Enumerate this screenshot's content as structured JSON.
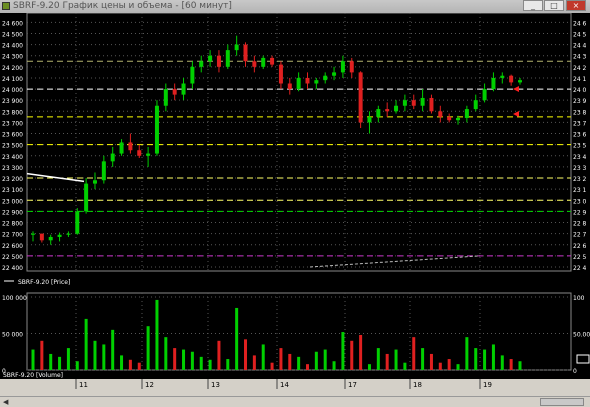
{
  "window": {
    "title": "SBRF-9.20 График цены и объема - [60 минут]",
    "buttons": {
      "minimize": "_",
      "maximize": "□",
      "close": "×"
    }
  },
  "price_panel": {
    "legend": "SBRF-9.20 [Price]",
    "y_ticks": [
      "24 600",
      "24 500",
      "24 400",
      "24 300",
      "24 200",
      "24 100",
      "24 000",
      "23 900",
      "23 800",
      "23 700",
      "23 600",
      "23 500",
      "23 400",
      "23 300",
      "23 200",
      "23 100",
      "23 000",
      "22 900",
      "22 800",
      "22 700",
      "22 600",
      "22 500",
      "22 400"
    ],
    "y_ticks_right": [
      "24 6",
      "24 5",
      "24 4",
      "24 3",
      "24 2",
      "24 1",
      "24 0",
      "23 9",
      "23 8",
      "23 7",
      "23 6",
      "23 5",
      "23 4",
      "23 3",
      "23 2",
      "23 1",
      "23 0",
      "22 9",
      "22 8",
      "22 7",
      "22 6",
      "22 5",
      "22 4"
    ]
  },
  "volume_panel": {
    "legend": "SBRF-9.20 [Volume]",
    "y_ticks": [
      "100 000",
      "50 000",
      "0"
    ],
    "y_ticks_right": [
      "100",
      "50.00",
      "0"
    ]
  },
  "x_axis": {
    "labels": [
      "11",
      "12",
      "13",
      "14",
      "17",
      "18",
      "19"
    ]
  },
  "chart_data": [
    {
      "type": "candlestick",
      "series": [
        {
          "name": "SBRF-9.20",
          "values": [
            {
              "o": 22690,
              "h": 22720,
              "l": 22630,
              "c": 22700
            },
            {
              "o": 22700,
              "h": 22700,
              "l": 22620,
              "c": 22640
            },
            {
              "o": 22640,
              "h": 22690,
              "l": 22600,
              "c": 22670
            },
            {
              "o": 22670,
              "h": 22710,
              "l": 22630,
              "c": 22690
            },
            {
              "o": 22690,
              "h": 22720,
              "l": 22670,
              "c": 22700
            },
            {
              "o": 22700,
              "h": 22930,
              "l": 22690,
              "c": 22900
            },
            {
              "o": 22900,
              "h": 23200,
              "l": 22880,
              "c": 23150
            },
            {
              "o": 23150,
              "h": 23250,
              "l": 23100,
              "c": 23180
            },
            {
              "o": 23180,
              "h": 23400,
              "l": 23150,
              "c": 23350
            },
            {
              "o": 23350,
              "h": 23480,
              "l": 23300,
              "c": 23420
            },
            {
              "o": 23420,
              "h": 23550,
              "l": 23400,
              "c": 23520
            },
            {
              "o": 23520,
              "h": 23600,
              "l": 23420,
              "c": 23450
            },
            {
              "o": 23450,
              "h": 23500,
              "l": 23380,
              "c": 23400
            },
            {
              "o": 23400,
              "h": 23480,
              "l": 23300,
              "c": 23420
            },
            {
              "o": 23420,
              "h": 23900,
              "l": 23400,
              "c": 23850
            },
            {
              "o": 23850,
              "h": 24050,
              "l": 23800,
              "c": 24000
            },
            {
              "o": 24000,
              "h": 24050,
              "l": 23900,
              "c": 23950
            },
            {
              "o": 23950,
              "h": 24100,
              "l": 23900,
              "c": 24050
            },
            {
              "o": 24050,
              "h": 24250,
              "l": 24000,
              "c": 24200
            },
            {
              "o": 24200,
              "h": 24300,
              "l": 24150,
              "c": 24250
            },
            {
              "o": 24250,
              "h": 24350,
              "l": 24200,
              "c": 24300
            },
            {
              "o": 24300,
              "h": 24350,
              "l": 24150,
              "c": 24200
            },
            {
              "o": 24200,
              "h": 24400,
              "l": 24180,
              "c": 24350
            },
            {
              "o": 24350,
              "h": 24480,
              "l": 24300,
              "c": 24400
            },
            {
              "o": 24400,
              "h": 24420,
              "l": 24200,
              "c": 24250
            },
            {
              "o": 24250,
              "h": 24300,
              "l": 24150,
              "c": 24200
            },
            {
              "o": 24200,
              "h": 24300,
              "l": 24180,
              "c": 24280
            },
            {
              "o": 24280,
              "h": 24300,
              "l": 24200,
              "c": 24220
            },
            {
              "o": 24220,
              "h": 24250,
              "l": 24000,
              "c": 24050
            },
            {
              "o": 24050,
              "h": 24100,
              "l": 23950,
              "c": 24000
            },
            {
              "o": 24000,
              "h": 24150,
              "l": 23980,
              "c": 24100
            },
            {
              "o": 24100,
              "h": 24150,
              "l": 24000,
              "c": 24050
            },
            {
              "o": 24050,
              "h": 24100,
              "l": 24000,
              "c": 24080
            },
            {
              "o": 24080,
              "h": 24150,
              "l": 24050,
              "c": 24120
            },
            {
              "o": 24120,
              "h": 24200,
              "l": 24080,
              "c": 24150
            },
            {
              "o": 24150,
              "h": 24300,
              "l": 24100,
              "c": 24250
            },
            {
              "o": 24250,
              "h": 24280,
              "l": 24100,
              "c": 24150
            },
            {
              "o": 24150,
              "h": 24160,
              "l": 23650,
              "c": 23700
            },
            {
              "o": 23700,
              "h": 23800,
              "l": 23600,
              "c": 23750
            },
            {
              "o": 23750,
              "h": 23850,
              "l": 23700,
              "c": 23820
            },
            {
              "o": 23820,
              "h": 23880,
              "l": 23750,
              "c": 23800
            },
            {
              "o": 23800,
              "h": 23900,
              "l": 23780,
              "c": 23850
            },
            {
              "o": 23850,
              "h": 23950,
              "l": 23800,
              "c": 23900
            },
            {
              "o": 23900,
              "h": 23950,
              "l": 23820,
              "c": 23850
            },
            {
              "o": 23850,
              "h": 24000,
              "l": 23800,
              "c": 23920
            },
            {
              "o": 23920,
              "h": 23950,
              "l": 23780,
              "c": 23800
            },
            {
              "o": 23800,
              "h": 23850,
              "l": 23700,
              "c": 23750
            },
            {
              "o": 23750,
              "h": 23780,
              "l": 23700,
              "c": 23720
            },
            {
              "o": 23720,
              "h": 23760,
              "l": 23680,
              "c": 23740
            },
            {
              "o": 23740,
              "h": 23850,
              "l": 23700,
              "c": 23820
            },
            {
              "o": 23820,
              "h": 23950,
              "l": 23800,
              "c": 23900
            },
            {
              "o": 23900,
              "h": 24050,
              "l": 23880,
              "c": 24000
            },
            {
              "o": 24000,
              "h": 24150,
              "l": 23980,
              "c": 24100
            },
            {
              "o": 24100,
              "h": 24150,
              "l": 24050,
              "c": 24120
            },
            {
              "o": 24120,
              "h": 24130,
              "l": 24030,
              "c": 24060
            },
            {
              "o": 24060,
              "h": 24100,
              "l": 24040,
              "c": 24080
            }
          ]
        }
      ],
      "x_labels": [
        "11",
        "12",
        "13",
        "14",
        "17",
        "18",
        "19"
      ],
      "ylim": [
        22400,
        24630
      ],
      "levels": [
        {
          "value": 24250,
          "color": "#b4b46e",
          "style": "dash"
        },
        {
          "value": 24000,
          "color": "#ffffff",
          "style": "dash"
        },
        {
          "value": 23750,
          "color": "#ffff00",
          "style": "dash"
        },
        {
          "value": 23500,
          "color": "#ffff00",
          "style": "dash"
        },
        {
          "value": 23200,
          "color": "#ffff66",
          "style": "dash"
        },
        {
          "value": 23000,
          "color": "#ffff66",
          "style": "dash"
        },
        {
          "value": 22900,
          "color": "#00dd00",
          "style": "dash"
        },
        {
          "value": 22500,
          "color": "#cc33cc",
          "style": "dash"
        }
      ],
      "grid": true
    },
    {
      "type": "bar",
      "series": [
        {
          "name": "Volume",
          "values": [
            28000,
            40000,
            22000,
            18000,
            30000,
            12000,
            70000,
            40000,
            35000,
            55000,
            20000,
            14000,
            10000,
            60000,
            96000,
            45000,
            30000,
            28000,
            25000,
            18000,
            14000,
            40000,
            15000,
            85000,
            42000,
            20000,
            35000,
            10000,
            30000,
            22000,
            18000,
            8000,
            25000,
            28000,
            12000,
            52000,
            40000,
            48000,
            8000,
            30000,
            22000,
            28000,
            10000,
            45000,
            30000,
            22000,
            10000,
            15000,
            8000,
            45000,
            30000,
            28000,
            35000,
            20000,
            15000,
            12000
          ]
        }
      ],
      "ylim": [
        0,
        100000
      ],
      "grid": true
    }
  ],
  "colors": {
    "up": "#00d000",
    "down": "#e02020",
    "grid": "#555555",
    "axis": "#ffffff"
  }
}
